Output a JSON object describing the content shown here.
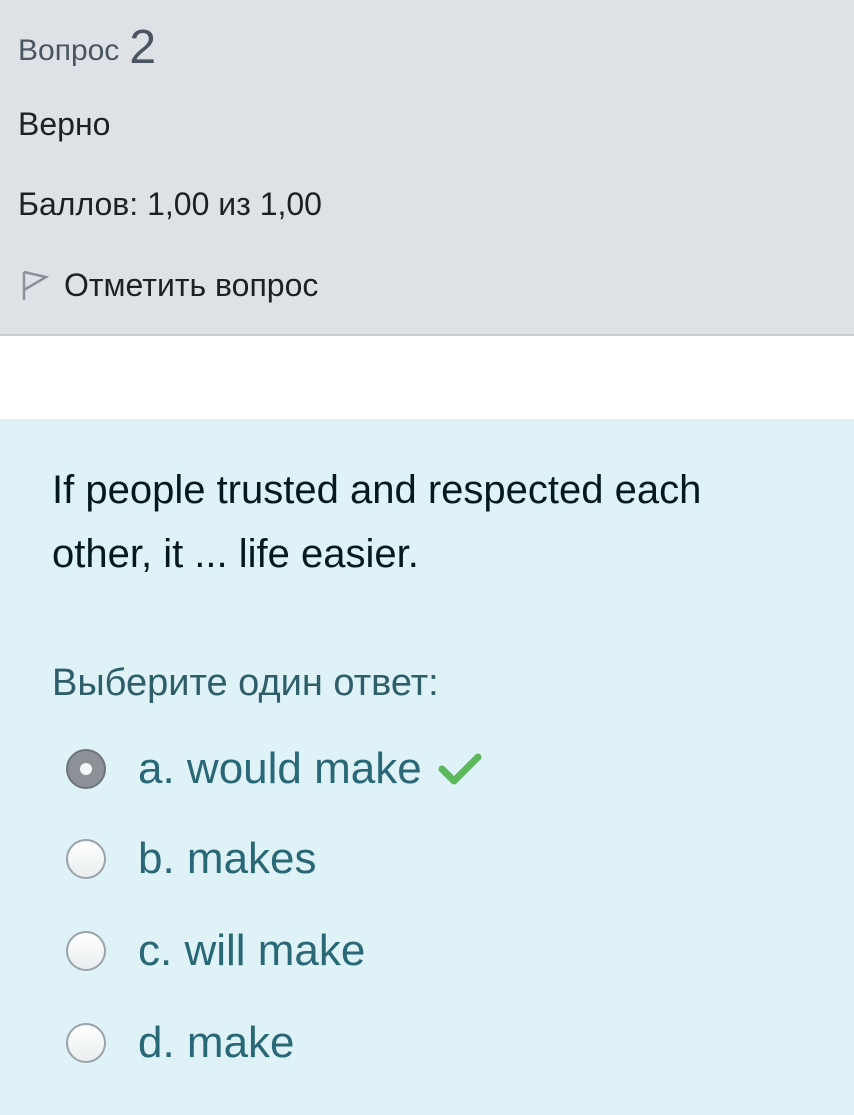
{
  "question_info": {
    "label": "Вопрос",
    "number": "2",
    "state": "Верно",
    "grade": "Баллов: 1,00 из 1,00",
    "flag_label": "Отметить вопрос"
  },
  "question": {
    "text": "If people trusted and respected each other, it ...  life easier.",
    "prompt": "Выберите один ответ:",
    "options": [
      {
        "label": "a. would make",
        "selected": true,
        "correct": true
      },
      {
        "label": "b. makes",
        "selected": false
      },
      {
        "label": "c. will make",
        "selected": false
      },
      {
        "label": "d. make",
        "selected": false
      }
    ]
  },
  "icons": {
    "flag": "flag-outline-icon",
    "correct": "checkmark-icon"
  },
  "colors": {
    "info_bg": "#dee2e6",
    "content_bg": "#def2f8",
    "correct_green": "#5cb85c",
    "option_text": "#2a6877"
  }
}
